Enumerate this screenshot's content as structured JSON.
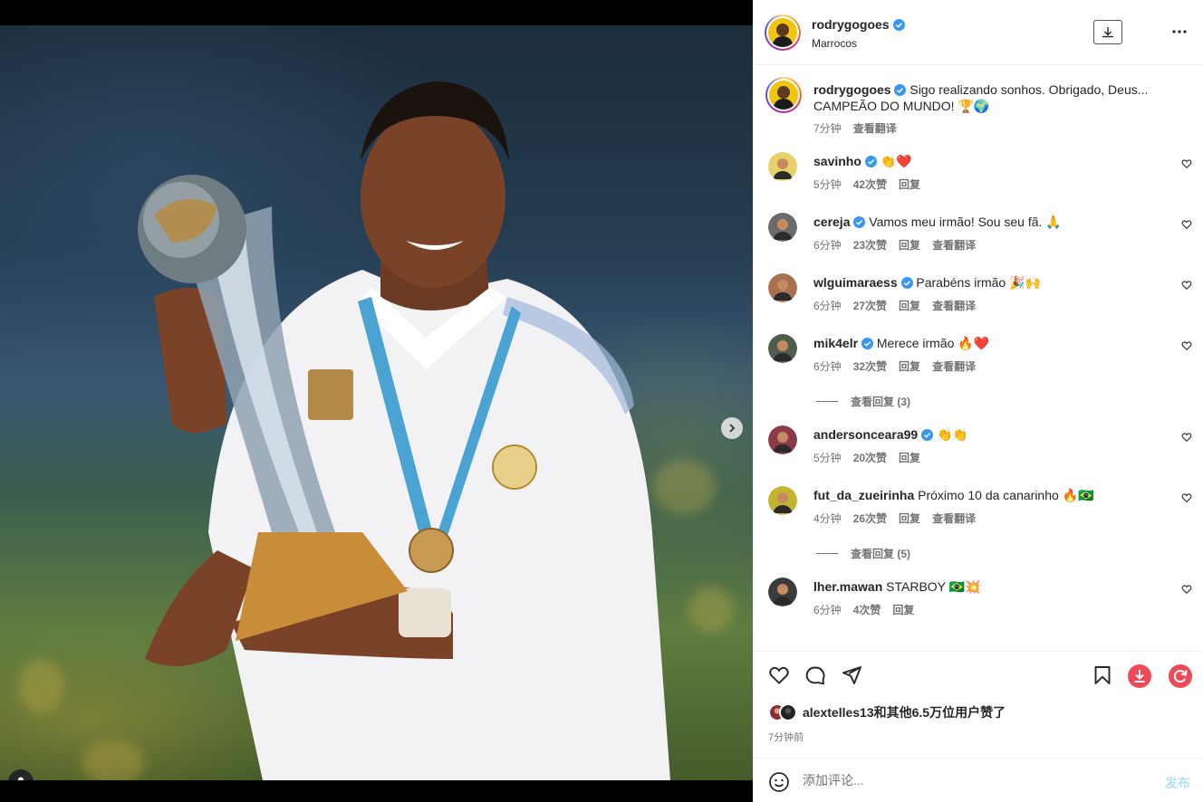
{
  "post": {
    "username": "rodrygogoes",
    "location": "Marrocos",
    "caption_line1": "Sigo realizando sonhos. Obrigado, Deus...",
    "caption_line2": "CAMPEÃO DO MUNDO! 🏆🌍",
    "caption_time": "7分钟",
    "caption_translate": "查看翻译"
  },
  "media": {
    "carousel_count": 2,
    "carousel_active_index": 0
  },
  "comments": [
    {
      "user": "savinho",
      "verified": true,
      "text": "👏❤️",
      "time": "5分钟",
      "likes": "42次赞",
      "reply": "回复",
      "translate": "",
      "avatar_color": "#e9d16a"
    },
    {
      "user": "cereja",
      "verified": true,
      "text": "Vamos meu irmão! Sou seu fã. 🙏",
      "time": "6分钟",
      "likes": "23次赞",
      "reply": "回复",
      "translate": "查看翻译",
      "avatar_color": "#6b6b6b"
    },
    {
      "user": "wlguimaraess",
      "verified": true,
      "text": "Parabéns irmão 🎉🙌",
      "time": "6分钟",
      "likes": "27次赞",
      "reply": "回复",
      "translate": "查看翻译",
      "avatar_color": "#a97050"
    },
    {
      "user": "mik4elr",
      "verified": true,
      "text": "Merece irmão 🔥❤️",
      "time": "6分钟",
      "likes": "32次赞",
      "reply": "回复",
      "translate": "查看翻译",
      "avatar_color": "#4f5d4c"
    },
    {
      "user": "andersonceara99",
      "verified": true,
      "text": "👏👏",
      "time": "5分钟",
      "likes": "20次赞",
      "reply": "回复",
      "translate": "",
      "avatar_color": "#8b3a4a"
    },
    {
      "user": "fut_da_zueirinha",
      "verified": false,
      "text": "Próximo 10 da canarinho 🔥🇧🇷",
      "time": "4分钟",
      "likes": "26次赞",
      "reply": "回复",
      "translate": "查看翻译",
      "avatar_color": "#c5b431"
    },
    {
      "user": "lher.mawan",
      "verified": false,
      "text": "STARBOY 🇧🇷💥",
      "time": "6分钟",
      "likes": "4次赞",
      "reply": "回复",
      "translate": "",
      "avatar_color": "#3c3c3c"
    }
  ],
  "view_replies": [
    {
      "label": "查看回复 (3)"
    },
    {
      "label": "查看回复 (5)"
    }
  ],
  "likes": {
    "text": "alextelles13和其他6.5万位用户赞了",
    "time_ago": "7分钟前"
  },
  "compose": {
    "placeholder": "添加评论...",
    "post_label": "发布"
  },
  "colors": {
    "accent_blue": "#0095f6",
    "verified_blue": "#3897f0",
    "download_red": "#ed4956",
    "post_disabled": "#b2dffc"
  },
  "icons": {
    "header": [
      "download-icon",
      "more-icon"
    ],
    "actions": [
      "heart-icon",
      "comment-icon",
      "share-icon",
      "bookmark-icon",
      "download-circle-icon",
      "refresh-circle-icon"
    ]
  }
}
